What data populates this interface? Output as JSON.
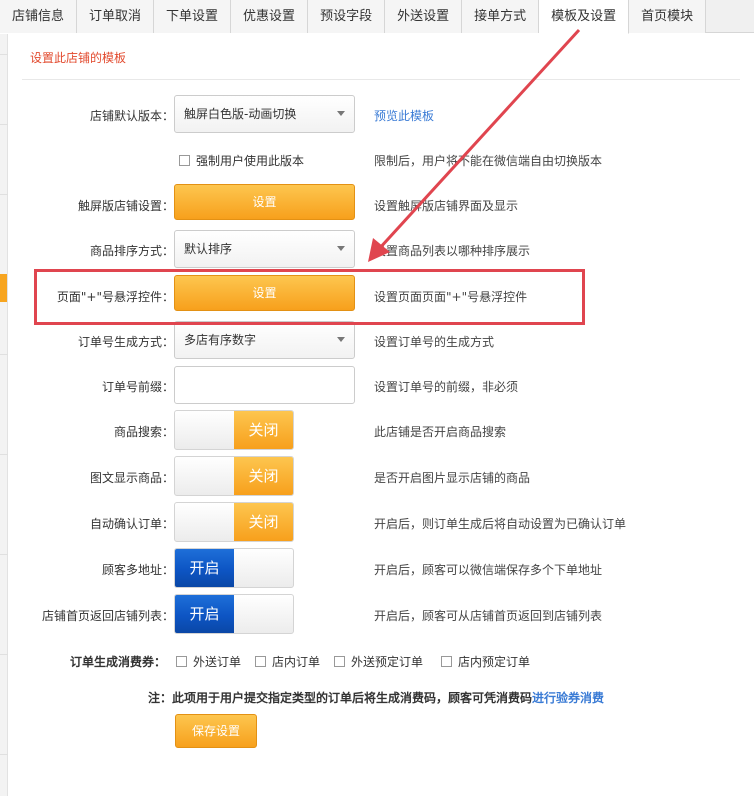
{
  "tabs": [
    {
      "label": "店铺信息",
      "active": false
    },
    {
      "label": "订单取消",
      "active": false
    },
    {
      "label": "下单设置",
      "active": false
    },
    {
      "label": "优惠设置",
      "active": false
    },
    {
      "label": "预设字段",
      "active": false
    },
    {
      "label": "外送设置",
      "active": false
    },
    {
      "label": "接单方式",
      "active": false
    },
    {
      "label": "模板及设置",
      "active": true
    },
    {
      "label": "首页模块",
      "active": false
    }
  ],
  "page": {
    "subtitle": "设置此店铺的模板"
  },
  "rows": {
    "template": {
      "label": "店铺默认版本：",
      "value": "触屏白色版-动画切换",
      "preview_link": "预览此模板"
    },
    "force": {
      "checkbox_label": "强制用户使用此版本",
      "desc": "限制后，用户将不能在微信端自由切换版本",
      "checked": false
    },
    "touch_settings": {
      "label": "触屏版店铺设置：",
      "button": "设置",
      "desc": "设置触屏版店铺界面及显示"
    },
    "sort": {
      "label": "商品排序方式：",
      "value": "默认排序",
      "desc": "设置商品列表以哪种排序展示"
    },
    "float_control": {
      "label": "页面\"+\"号悬浮控件：",
      "button": "设置",
      "desc": "设置页面页面\"+\"号悬浮控件"
    },
    "order_no_mode": {
      "label": "订单号生成方式：",
      "value": "多店有序数字",
      "desc": "设置订单号的生成方式"
    },
    "order_prefix": {
      "label": "订单号前缀：",
      "value": "",
      "desc": "设置订单号的前缀，非必须"
    },
    "product_search": {
      "label": "商品搜索：",
      "state": "关闭",
      "desc": "此店铺是否开启商品搜索"
    },
    "image_display": {
      "label": "图文显示商品：",
      "state": "关闭",
      "desc": "是否开启图片显示店铺的商品"
    },
    "auto_confirm": {
      "label": "自动确认订单：",
      "state": "关闭",
      "desc": "开启后，则订单生成后将自动设置为已确认订单"
    },
    "multi_address": {
      "label": "顾客多地址：",
      "state": "开启",
      "desc": "开启后，顾客可以微信端保存多个下单地址"
    },
    "back_to_list": {
      "label": "店铺首页返回店铺列表：",
      "state": "开启",
      "desc": "开启后，顾客可从店铺首页返回到店铺列表"
    }
  },
  "coupon": {
    "label": "订单生成消费券：",
    "options": [
      "外送订单",
      "店内订单",
      "外送预定订单",
      "店内预定订单"
    ]
  },
  "note": {
    "text": "注：此项用于用户提交指定类型的订单后将生成消费码，顾客可凭消费码",
    "link": "进行验券消费"
  },
  "save_button": "保存设置",
  "colors": {
    "accent_orange": "#f7a01c",
    "toggle_on_blue": "#0d55c4",
    "highlight_red": "#e0454f",
    "subtitle_red": "#e24a2e",
    "link_blue": "#3a7bd5"
  }
}
